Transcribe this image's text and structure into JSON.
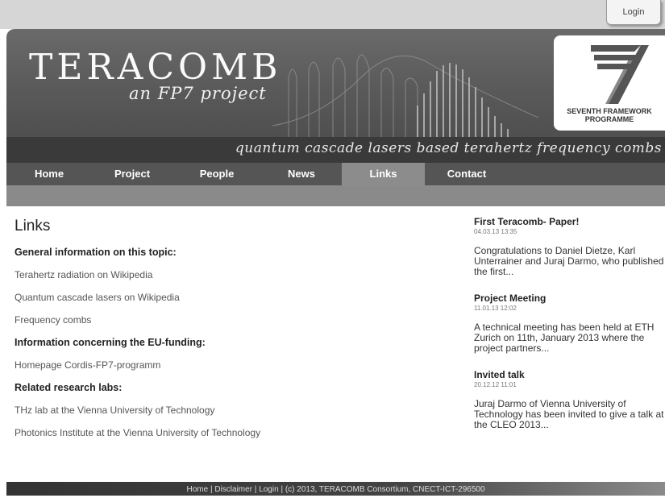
{
  "header": {
    "login_label": "Login",
    "logo_title": "TERACOMB",
    "logo_subtitle": "an FP7 project",
    "fp7_caption_line1": "SEVENTH FRAMEWORK",
    "fp7_caption_line2": "PROGRAMME",
    "tagline": "quantum cascade lasers based terahertz frequency combs"
  },
  "nav": {
    "items": [
      {
        "label": "Home"
      },
      {
        "label": "Project"
      },
      {
        "label": "People"
      },
      {
        "label": "News"
      },
      {
        "label": "Links"
      },
      {
        "label": "Contact"
      }
    ],
    "active": "Links"
  },
  "main": {
    "title": "Links",
    "sections": [
      {
        "heading": "General information on this topic:",
        "links": [
          "Terahertz radiation on Wikipedia",
          "Quantum cascade lasers on Wikipedia",
          "Frequency combs"
        ]
      },
      {
        "heading": "Information concerning the EU-funding:",
        "links": [
          "Homepage Cordis-FP7-programm"
        ]
      },
      {
        "heading": "Related research labs:",
        "links": [
          "THz lab at the Vienna University of Technology",
          "Photonics Institute at the Vienna University of Technology"
        ]
      }
    ]
  },
  "sidebar": {
    "news": [
      {
        "title": "First Teracomb- Paper!",
        "date": "04.03.13 13:35",
        "text": "Congratulations to Daniel Dietze, Karl Unterrainer and Juraj Darmo, who published the first..."
      },
      {
        "title": "Project Meeting",
        "date": "11.01.13 12:02",
        "text": "A technical meeting has been held at ETH Zurich on 11th, January 2013 where the project partners..."
      },
      {
        "title": "Invited talk",
        "date": "20.12.12 11:01",
        "text": "Juraj Darmo of Vienna University of Technology has been invited to give a talk at the CLEO 2013..."
      }
    ]
  },
  "footer": {
    "home": "Home",
    "disclaimer": "Disclaimer",
    "login": "Login",
    "copyright": "(c) 2013, TERACOMB Consortium, CNECT-ICT-296500",
    "separator": "|"
  },
  "colors": {
    "banner": "#5a5a5a",
    "nav": "#555555",
    "nav_active": "#8c8c8c",
    "subbar": "#8a8a8a"
  }
}
